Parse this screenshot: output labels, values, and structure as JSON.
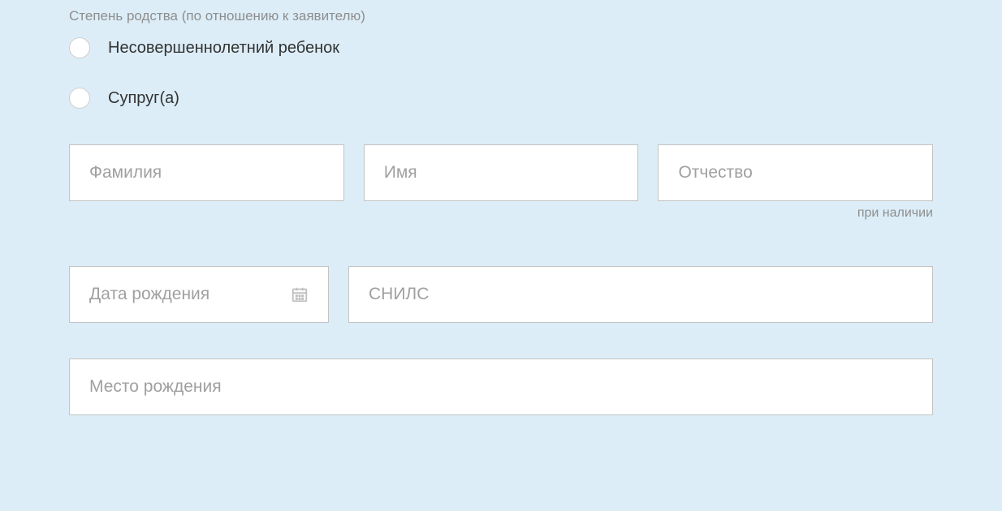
{
  "relationship": {
    "label": "Степень родства (по отношению к заявителю)",
    "options": [
      {
        "label": "Несовершеннолетний ребенок"
      },
      {
        "label": "Супруг(а)"
      }
    ]
  },
  "fields": {
    "surname": {
      "placeholder": "Фамилия",
      "value": ""
    },
    "name": {
      "placeholder": "Имя",
      "value": ""
    },
    "patronymic": {
      "placeholder": "Отчество",
      "value": "",
      "hint": "при наличии"
    },
    "dob": {
      "placeholder": "Дата рождения",
      "value": ""
    },
    "snils": {
      "placeholder": "СНИЛС",
      "value": ""
    },
    "pob": {
      "placeholder": "Место рождения",
      "value": ""
    }
  }
}
